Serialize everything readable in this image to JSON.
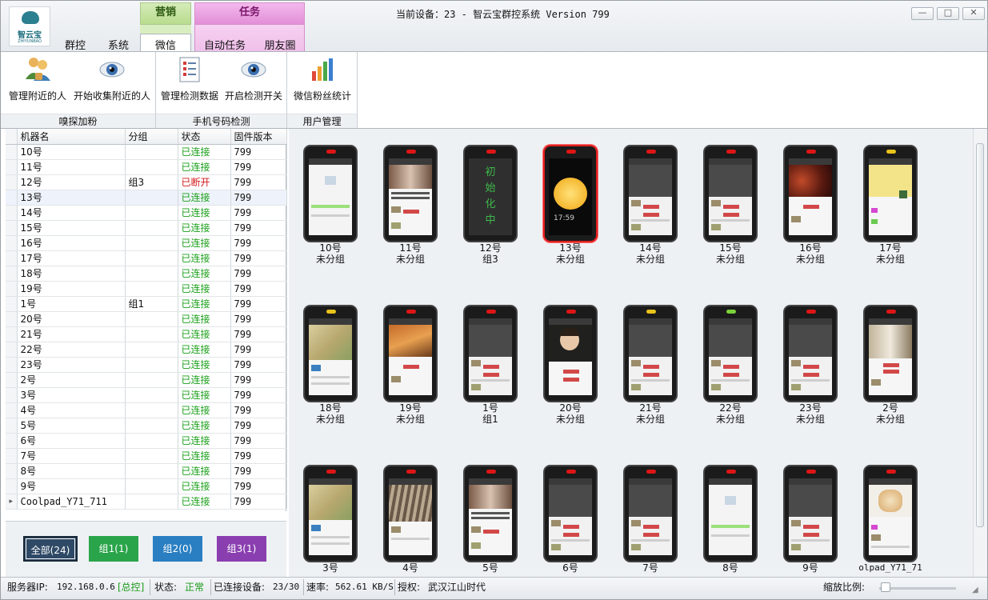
{
  "window": {
    "title": "当前设备：23 - 智云宝群控系统 Version 799",
    "minimize": "—",
    "restore": "□",
    "close": "✕"
  },
  "logo": {
    "text": "智云宝",
    "sub": "ZHIYUNBAO"
  },
  "tab_groups": {
    "marketing": "营销",
    "task": "任务"
  },
  "tabs": [
    "群控",
    "系统",
    "微信",
    "自动任务",
    "朋友圈"
  ],
  "ribbon": {
    "groups": [
      {
        "label": "嗅探加粉",
        "buttons": [
          "管理附近的人",
          "开始收集附近的人"
        ]
      },
      {
        "label": "手机号码检测",
        "buttons": [
          "管理检测数据",
          "开启检测开关"
        ]
      },
      {
        "label": "用户管理",
        "buttons": [
          "微信粉丝统计"
        ]
      }
    ]
  },
  "table": {
    "headers": [
      "机器名",
      "分组",
      "状态",
      "固件版本"
    ],
    "rows": [
      {
        "name": "10号",
        "group": "",
        "status": "已连接",
        "fw": "799"
      },
      {
        "name": "11号",
        "group": "",
        "status": "已连接",
        "fw": "799"
      },
      {
        "name": "12号",
        "group": "组3",
        "status": "已断开",
        "fw": "799"
      },
      {
        "name": "13号",
        "group": "",
        "status": "已连接",
        "fw": "799"
      },
      {
        "name": "14号",
        "group": "",
        "status": "已连接",
        "fw": "799"
      },
      {
        "name": "15号",
        "group": "",
        "status": "已连接",
        "fw": "799"
      },
      {
        "name": "16号",
        "group": "",
        "status": "已连接",
        "fw": "799"
      },
      {
        "name": "17号",
        "group": "",
        "status": "已连接",
        "fw": "799"
      },
      {
        "name": "18号",
        "group": "",
        "status": "已连接",
        "fw": "799"
      },
      {
        "name": "19号",
        "group": "",
        "status": "已连接",
        "fw": "799"
      },
      {
        "name": "1号",
        "group": "组1",
        "status": "已连接",
        "fw": "799"
      },
      {
        "name": "20号",
        "group": "",
        "status": "已连接",
        "fw": "799"
      },
      {
        "name": "21号",
        "group": "",
        "status": "已连接",
        "fw": "799"
      },
      {
        "name": "22号",
        "group": "",
        "status": "已连接",
        "fw": "799"
      },
      {
        "name": "23号",
        "group": "",
        "status": "已连接",
        "fw": "799"
      },
      {
        "name": "2号",
        "group": "",
        "status": "已连接",
        "fw": "799"
      },
      {
        "name": "3号",
        "group": "",
        "status": "已连接",
        "fw": "799"
      },
      {
        "name": "4号",
        "group": "",
        "status": "已连接",
        "fw": "799"
      },
      {
        "name": "5号",
        "group": "",
        "status": "已连接",
        "fw": "799"
      },
      {
        "name": "6号",
        "group": "",
        "status": "已连接",
        "fw": "799"
      },
      {
        "name": "7号",
        "group": "",
        "status": "已连接",
        "fw": "799"
      },
      {
        "name": "8号",
        "group": "",
        "status": "已连接",
        "fw": "799"
      },
      {
        "name": "9号",
        "group": "",
        "status": "已连接",
        "fw": "799"
      },
      {
        "name": "Coolpad_Y71_711",
        "group": "",
        "status": "已连接",
        "fw": "799"
      }
    ]
  },
  "group_buttons": [
    {
      "label": "全部(24)",
      "color": "#2f4a66"
    },
    {
      "label": "组1(1)",
      "color": "#2aa44a"
    },
    {
      "label": "组2(0)",
      "color": "#2a7fc2"
    },
    {
      "label": "组3(1)",
      "color": "#8a3fb0"
    }
  ],
  "devices": [
    {
      "name": "10号",
      "group": "未分组",
      "screen": "chat-white",
      "led": "#e01515"
    },
    {
      "name": "11号",
      "group": "未分组",
      "screen": "photo-news",
      "led": "#e01515"
    },
    {
      "name": "12号",
      "group": "组3",
      "screen": "init",
      "led": "#e01515",
      "init_text": "初始化中"
    },
    {
      "name": "13号",
      "group": "未分组",
      "screen": "lemon",
      "led": "#e01515",
      "selected": true,
      "clock": "17:59"
    },
    {
      "name": "14号",
      "group": "未分组",
      "screen": "chat-dark",
      "led": "#e01515"
    },
    {
      "name": "15号",
      "group": "未分组",
      "screen": "chat-dark",
      "led": "#e01515"
    },
    {
      "name": "16号",
      "group": "未分组",
      "screen": "flowers",
      "led": "#e01515"
    },
    {
      "name": "17号",
      "group": "未分组",
      "screen": "yellow",
      "led": "#e8c21a"
    },
    {
      "name": "18号",
      "group": "未分组",
      "screen": "paper",
      "led": "#e8c21a"
    },
    {
      "name": "19号",
      "group": "未分组",
      "screen": "desert",
      "led": "#e01515"
    },
    {
      "name": "1号",
      "group": "组1",
      "screen": "chat-dark",
      "led": "#e01515"
    },
    {
      "name": "20号",
      "group": "未分组",
      "screen": "kid",
      "led": "#e01515"
    },
    {
      "name": "21号",
      "group": "未分组",
      "screen": "chat-dark",
      "led": "#e8c21a"
    },
    {
      "name": "22号",
      "group": "未分组",
      "screen": "chat-dark",
      "led": "#7ad23a"
    },
    {
      "name": "23号",
      "group": "未分组",
      "screen": "chat-dark",
      "led": "#e01515"
    },
    {
      "name": "2号",
      "group": "未分组",
      "screen": "girl",
      "led": "#e01515"
    },
    {
      "name": "3号",
      "group": "",
      "screen": "paper",
      "led": "#e01515"
    },
    {
      "name": "4号",
      "group": "",
      "screen": "stripes",
      "led": "#e01515"
    },
    {
      "name": "5号",
      "group": "",
      "screen": "photo-news",
      "led": "#e01515"
    },
    {
      "name": "6号",
      "group": "",
      "screen": "chat-dark",
      "led": "#e01515"
    },
    {
      "name": "7号",
      "group": "",
      "screen": "chat-dark",
      "led": "#e01515"
    },
    {
      "name": "8号",
      "group": "",
      "screen": "chat-white",
      "led": "#e01515"
    },
    {
      "name": "9号",
      "group": "",
      "screen": "chat-dark",
      "led": "#e01515"
    },
    {
      "name": "olpad_Y71_71",
      "group": "",
      "screen": "dog",
      "led": "#e01515"
    }
  ],
  "statusbar": {
    "server_label": "服务器IP:",
    "server_ip": "192.168.0.6",
    "role": "[总控]",
    "state_label": "状态:",
    "state": "正常",
    "connected_label": "已连接设备:",
    "connected": "23/30",
    "rate_label": "速率:",
    "rate": "562.61 KB/S",
    "auth_label": "授权:",
    "auth": "武汉江山时代",
    "zoom_label": "缩放比例:"
  }
}
